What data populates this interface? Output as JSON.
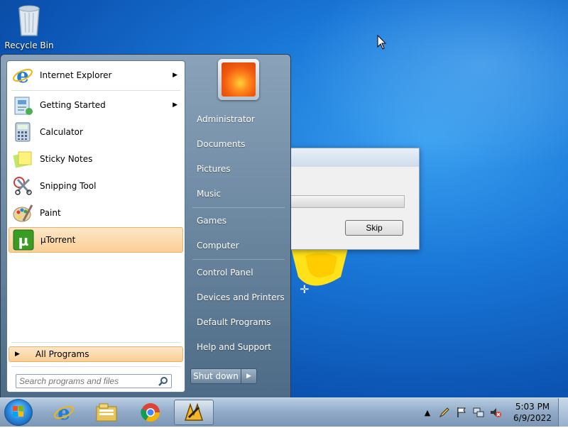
{
  "desktop": {
    "icons": [
      {
        "label": "Recycle Bin",
        "icon": "recycle-bin-icon"
      }
    ]
  },
  "dialog": {
    "skip_label": "Skip",
    "progress": 0
  },
  "start_menu": {
    "programs": [
      {
        "label": "Internet Explorer",
        "icon": "internet-explorer-icon",
        "has_submenu": true
      },
      {
        "label": "Getting Started",
        "icon": "getting-started-icon",
        "has_submenu": true
      },
      {
        "label": "Calculator",
        "icon": "calculator-icon",
        "has_submenu": false
      },
      {
        "label": "Sticky Notes",
        "icon": "sticky-notes-icon",
        "has_submenu": false
      },
      {
        "label": "Snipping Tool",
        "icon": "snipping-tool-icon",
        "has_submenu": false
      },
      {
        "label": "Paint",
        "icon": "paint-icon",
        "has_submenu": false
      },
      {
        "label": "µTorrent",
        "icon": "utorrent-icon",
        "has_submenu": false,
        "highlighted": true
      }
    ],
    "all_programs_label": "All Programs",
    "search_placeholder": "Search programs and files",
    "right_items": [
      "Administrator",
      "Documents",
      "Pictures",
      "Music",
      "Games",
      "Computer",
      "Control Panel",
      "Devices and Printers",
      "Default Programs",
      "Help and Support"
    ],
    "shutdown_label": "Shut down"
  },
  "taskbar": {
    "pinned": [
      "internet-explorer-icon",
      "windows-explorer-icon",
      "chrome-icon",
      "winamp-icon"
    ],
    "tray_icons": [
      "show-hidden-icons-icon",
      "pencil-icon",
      "action-center-flag-icon",
      "network-icon",
      "volume-muted-icon"
    ],
    "clock_time": "5:03 PM",
    "clock_date": "6/9/2022"
  },
  "colors": {
    "highlight": "#fbcf94",
    "desktop_blue": "#1a78d8"
  }
}
